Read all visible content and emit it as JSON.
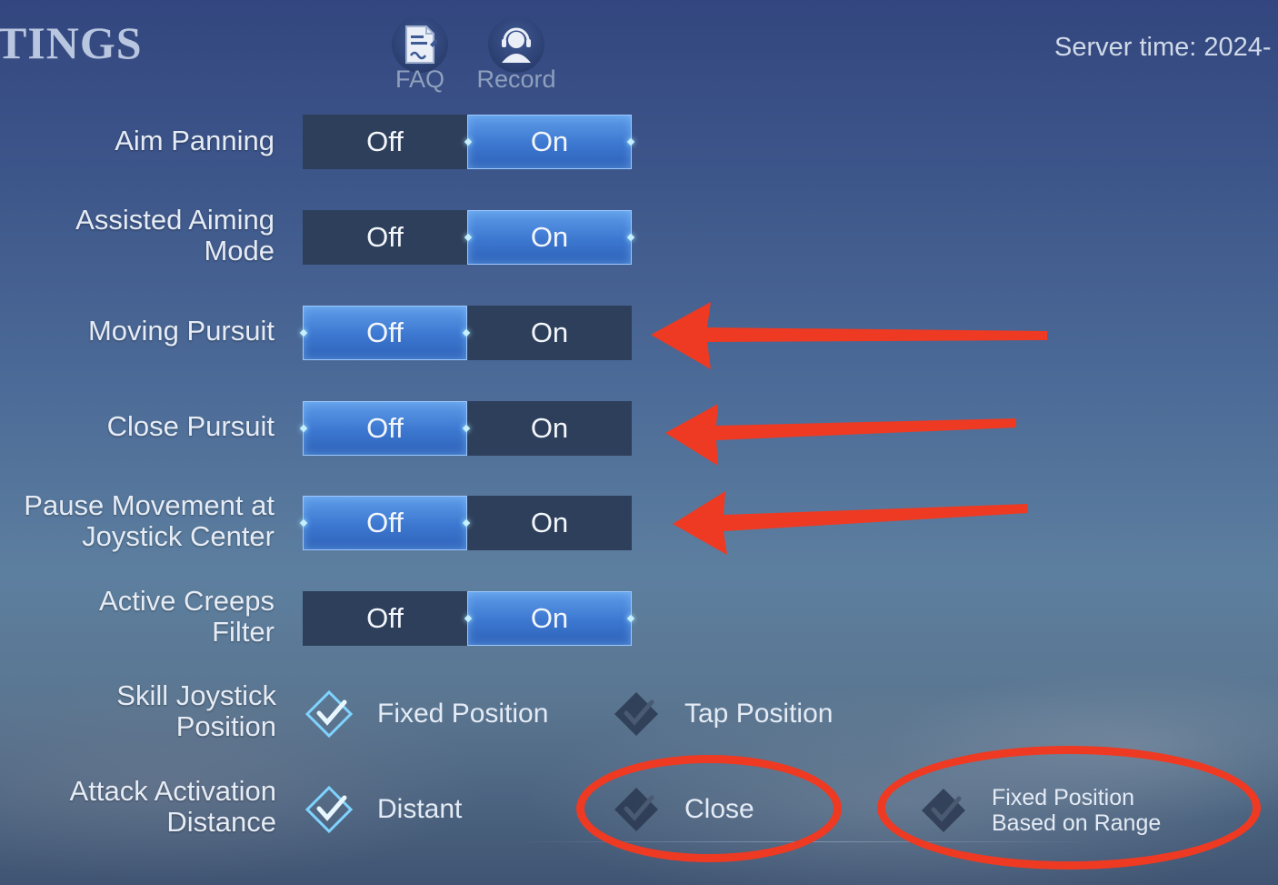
{
  "header": {
    "title": "TINGS",
    "faq_label": "FAQ",
    "record_label": "Record",
    "server_time": "Server time: 2024-"
  },
  "settings": [
    {
      "label": "Aim Panning",
      "off": "Off",
      "on": "On",
      "selected": "On"
    },
    {
      "label": "Assisted Aiming Mode",
      "off": "Off",
      "on": "On",
      "selected": "On"
    },
    {
      "label": "Moving Pursuit",
      "off": "Off",
      "on": "On",
      "selected": "Off"
    },
    {
      "label": "Close Pursuit",
      "off": "Off",
      "on": "On",
      "selected": "Off"
    },
    {
      "label": "Pause Movement at Joystick Center",
      "off": "Off",
      "on": "On",
      "selected": "Off"
    },
    {
      "label": "Active Creeps Filter",
      "off": "Off",
      "on": "On",
      "selected": "On"
    }
  ],
  "skill_joystick": {
    "label": "Skill Joystick Position",
    "options": [
      "Fixed Position",
      "Tap Position"
    ],
    "selected": "Fixed Position"
  },
  "attack_activation": {
    "label": "Attack Activation Distance",
    "options": [
      "Distant",
      "Close",
      "Fixed Position Based on Range"
    ],
    "selected": "Distant"
  },
  "annotations": {
    "arrow_color": "#ee3a22",
    "arrows_point_to": [
      "Moving Pursuit",
      "Close Pursuit",
      "Pause Movement at Joystick Center"
    ],
    "circled": [
      "Close",
      "Fixed Position Based on Range"
    ]
  },
  "colors": {
    "active_toggle": "#3c77d0",
    "inactive_toggle": "#2e3f5b"
  }
}
